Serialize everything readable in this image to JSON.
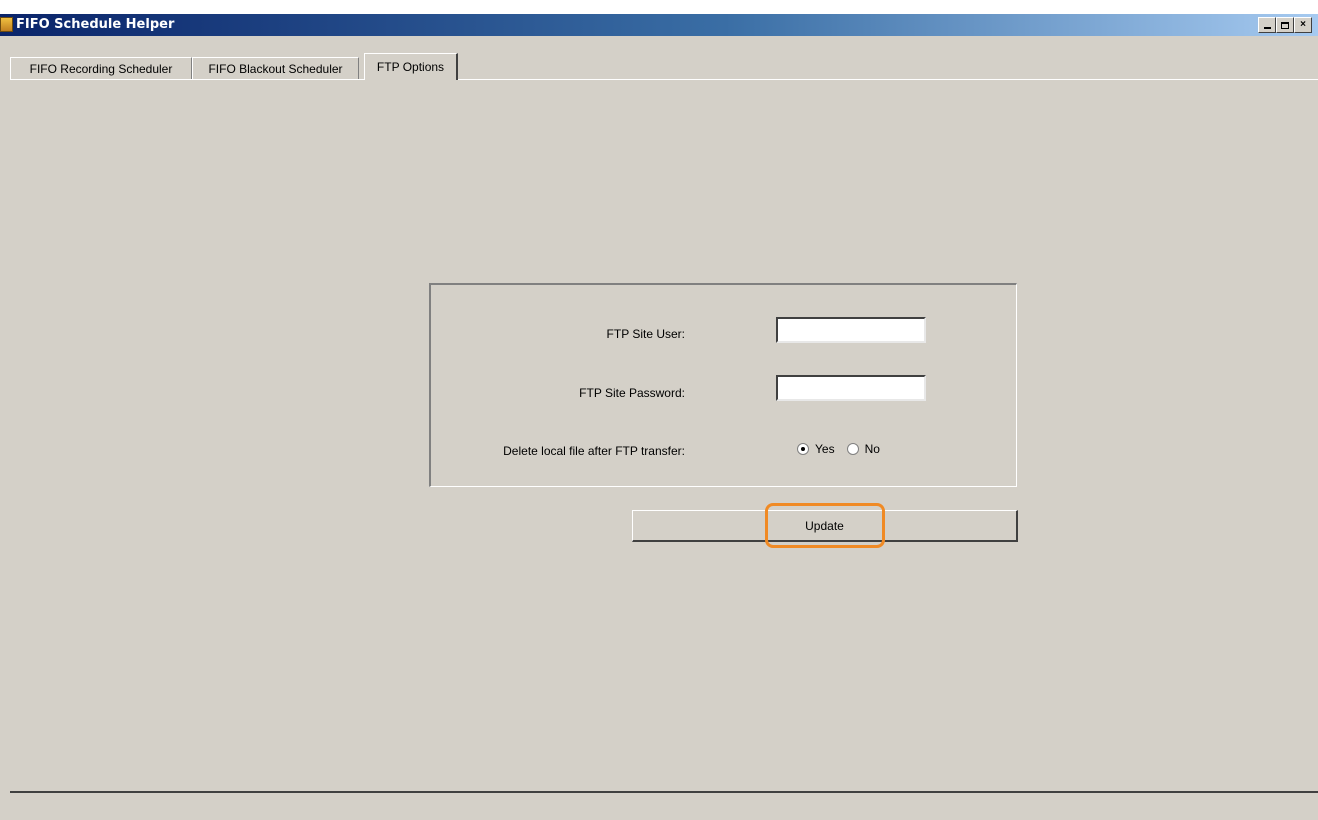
{
  "window": {
    "title": "FIFO Schedule Helper",
    "icon": "app-icon",
    "controls": [
      "minimize-icon",
      "maximize-icon",
      "close-icon"
    ],
    "close_glyph": "×"
  },
  "tabs": [
    {
      "label": "FIFO Recording Scheduler",
      "active": false
    },
    {
      "label": "FIFO Blackout Scheduler",
      "active": false
    },
    {
      "label": "FTP Options",
      "active": true
    }
  ],
  "form": {
    "user_label": "FTP Site User:",
    "user_value": "",
    "password_label": "FTP Site Password:",
    "password_value": "",
    "delete_label": "Delete local file after FTP transfer:",
    "radio_yes": "Yes",
    "radio_no": "No",
    "selected": "Yes"
  },
  "update_button": "Update",
  "colors": {
    "window_bg": "#d4d0c8",
    "titlebar_start": "#0a246a",
    "titlebar_end": "#a6caf0",
    "highlight": "#f08a24"
  }
}
